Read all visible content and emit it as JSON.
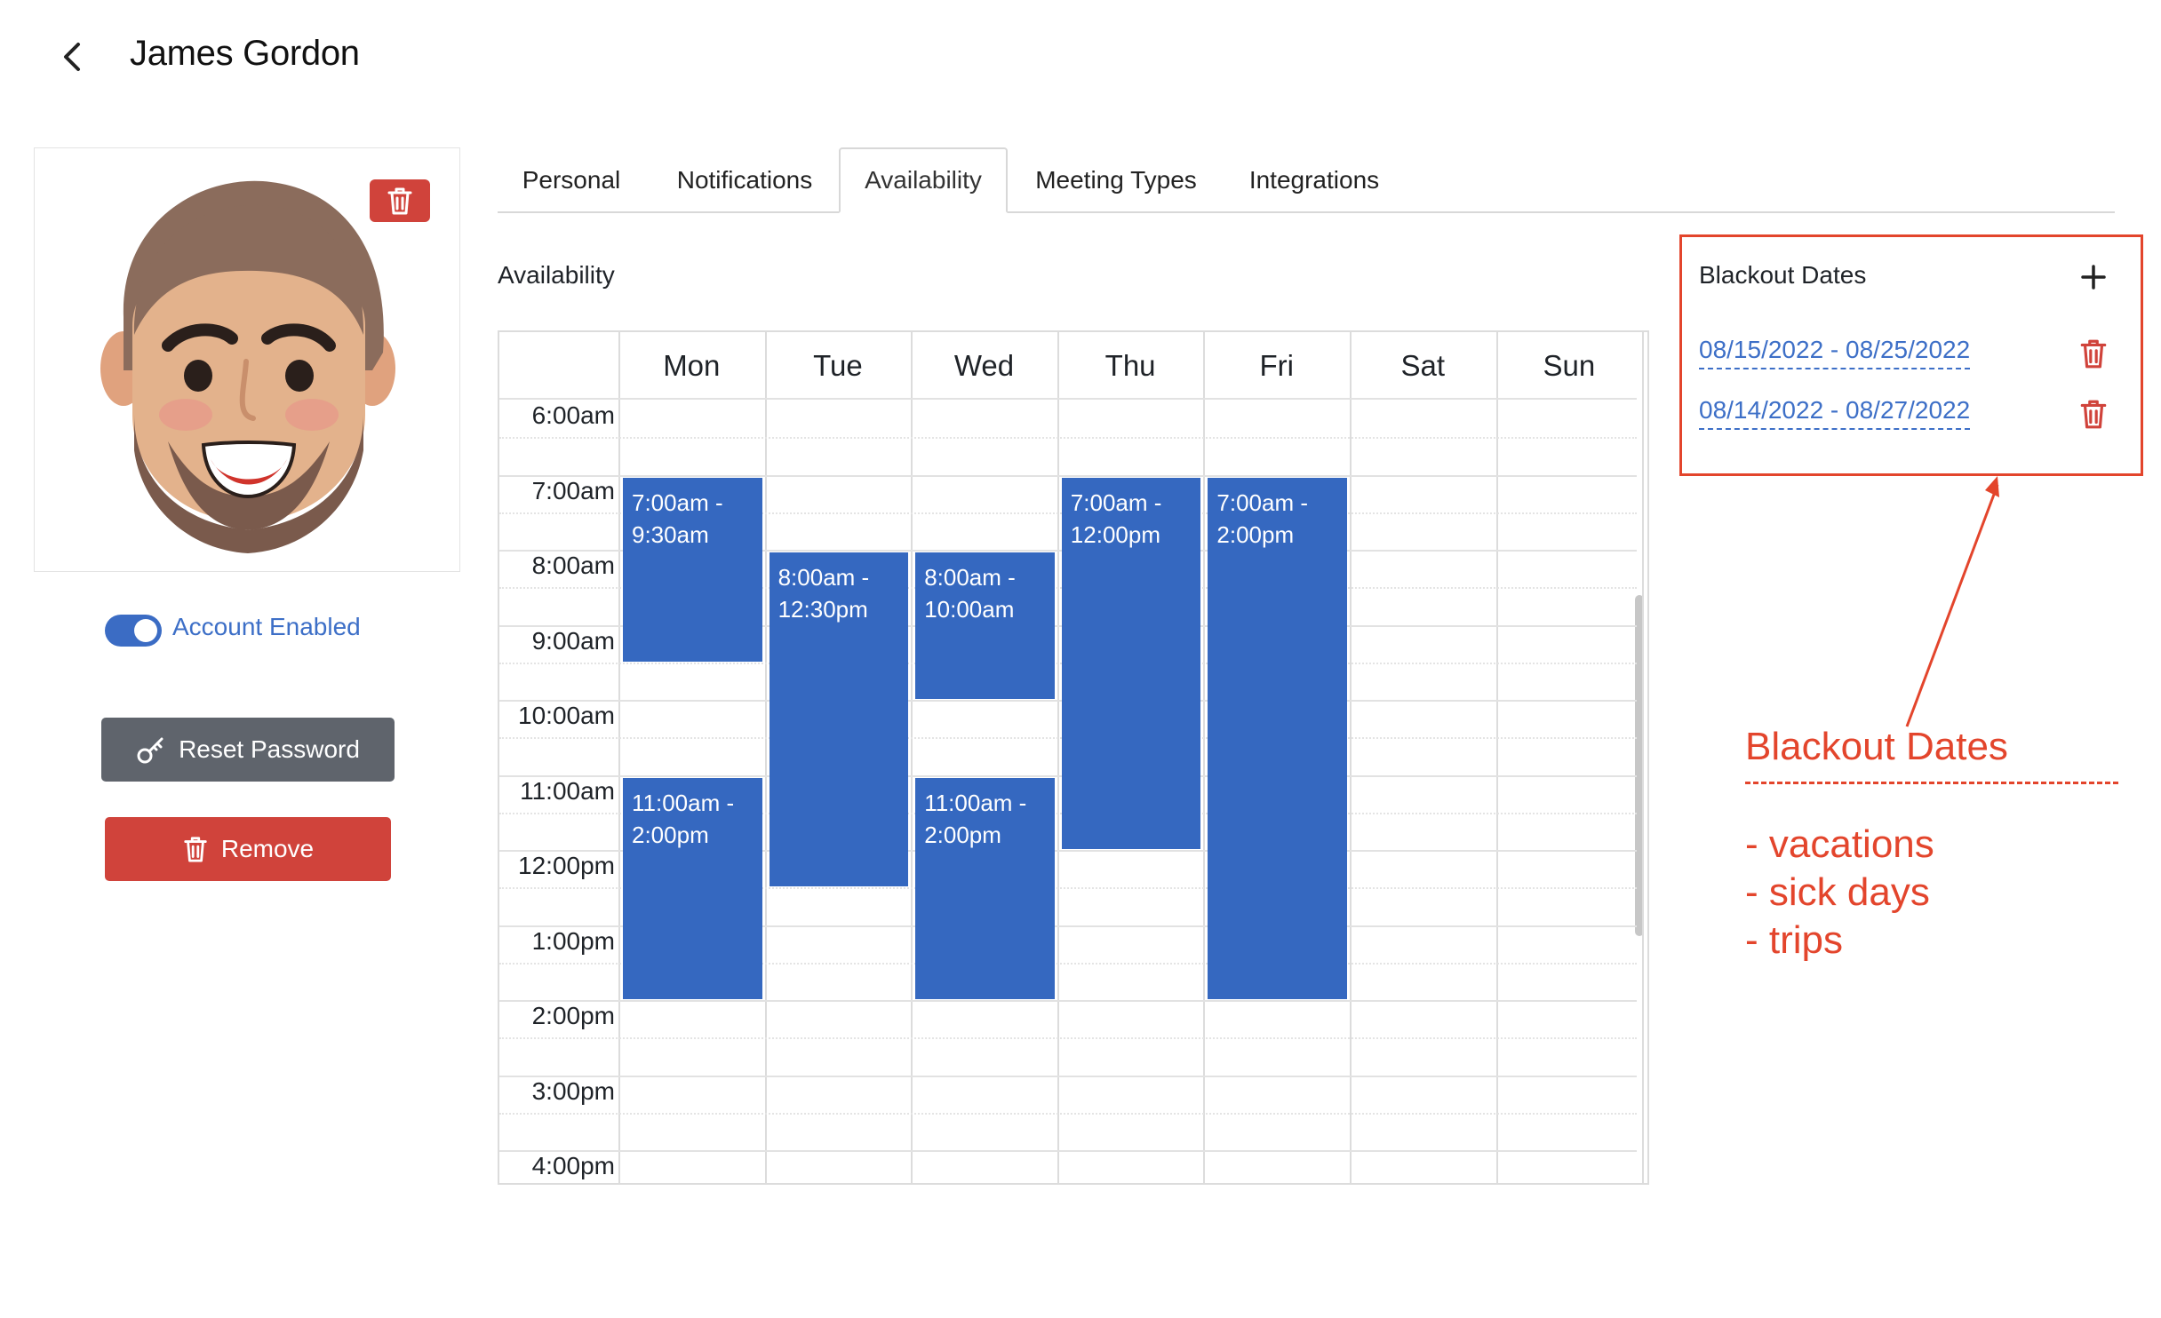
{
  "header": {
    "title": "James Gordon"
  },
  "profile": {
    "account_toggle_label": "Account Enabled",
    "reset_password_label": "Reset Password",
    "remove_label": "Remove"
  },
  "tabs": [
    {
      "label": "Personal"
    },
    {
      "label": "Notifications"
    },
    {
      "label": "Availability",
      "active": true
    },
    {
      "label": "Meeting Types"
    },
    {
      "label": "Integrations"
    }
  ],
  "availability": {
    "section_label": "Availability",
    "days": [
      "Mon",
      "Tue",
      "Wed",
      "Thu",
      "Fri",
      "Sat",
      "Sun"
    ],
    "times": [
      "6:00am",
      "7:00am",
      "8:00am",
      "9:00am",
      "10:00am",
      "11:00am",
      "12:00pm",
      "1:00pm",
      "2:00pm",
      "3:00pm",
      "4:00pm"
    ],
    "events": [
      {
        "day": 0,
        "start": 7.0,
        "end": 9.5,
        "line1": "7:00am -",
        "line2": "9:30am"
      },
      {
        "day": 0,
        "start": 11.0,
        "end": 14.0,
        "line1": "11:00am -",
        "line2": "2:00pm"
      },
      {
        "day": 1,
        "start": 8.0,
        "end": 12.5,
        "line1": "8:00am -",
        "line2": "12:30pm"
      },
      {
        "day": 2,
        "start": 8.0,
        "end": 10.0,
        "line1": "8:00am -",
        "line2": "10:00am"
      },
      {
        "day": 2,
        "start": 11.0,
        "end": 14.0,
        "line1": "11:00am -",
        "line2": "2:00pm"
      },
      {
        "day": 3,
        "start": 7.0,
        "end": 12.0,
        "line1": "7:00am -",
        "line2": "12:00pm"
      },
      {
        "day": 4,
        "start": 7.0,
        "end": 14.0,
        "line1": "7:00am -",
        "line2": "2:00pm"
      }
    ]
  },
  "blackout": {
    "title": "Blackout Dates",
    "ranges": [
      {
        "label": "08/15/2022 - 08/25/2022"
      },
      {
        "label": "08/14/2022 - 08/27/2022"
      }
    ]
  },
  "annotation": {
    "title": "Blackout Dates",
    "items": [
      "- vacations",
      "- sick days",
      "- trips"
    ],
    "color": "#e3452c"
  },
  "colors": {
    "accent": "#3d6fc7",
    "event": "#3568c0",
    "danger": "#d0433b",
    "secondary": "#5f646c"
  },
  "icons": {
    "back": "chevron-left-icon",
    "trash": "trash-icon",
    "key": "key-icon",
    "plus": "plus-icon"
  }
}
